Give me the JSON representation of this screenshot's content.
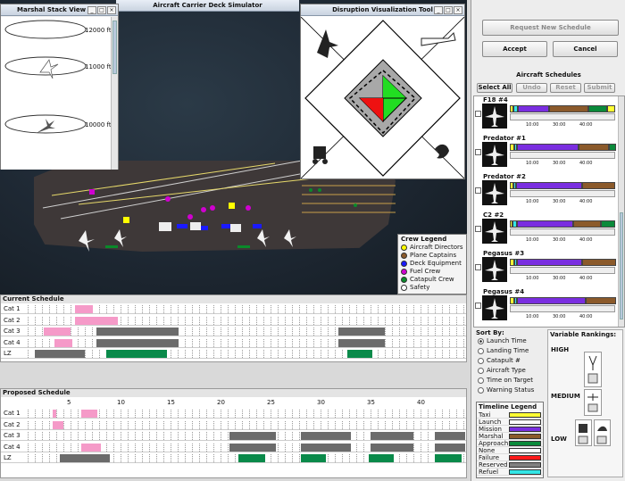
{
  "marshal": {
    "title": "Marshal Stack View",
    "altitudes": [
      "12000 ft",
      "11000 ft",
      "10000 ft"
    ]
  },
  "deck": {
    "title": "Aircraft Carrier Deck Simulator"
  },
  "disruption": {
    "title": "Disruption Visualization Tool"
  },
  "crew_legend": {
    "title": "Crew Legend",
    "items": [
      {
        "label": "Aircraft Directors",
        "color": "#ffff00"
      },
      {
        "label": "Plane Captains",
        "color": "#8b5a2b"
      },
      {
        "label": "Deck Equipment",
        "color": "#1a1aff"
      },
      {
        "label": "Fuel Crew",
        "color": "#d000d0"
      },
      {
        "label": "Catapult Crew",
        "color": "#0a8a2a"
      },
      {
        "label": "Safety",
        "color": "#ffffff"
      }
    ]
  },
  "controls": {
    "request": "Request New Schedule",
    "accept": "Accept",
    "cancel": "Cancel"
  },
  "aircraft_schedules": {
    "title": "Aircraft Schedules",
    "select_all": "Select All",
    "undo": "Undo",
    "reset": "Reset",
    "submit": "Submit",
    "items": [
      {
        "name": "F18 #4",
        "ticks": [
          "10:00",
          "30:00",
          "40:00"
        ]
      },
      {
        "name": "Predator #1",
        "ticks": [
          "10:00",
          "30:00",
          "40:00"
        ]
      },
      {
        "name": "Predator #2",
        "ticks": [
          "10:00",
          "30:00",
          "40:00"
        ]
      },
      {
        "name": "C2 #2",
        "ticks": [
          "10:00",
          "30:00",
          "40:00"
        ]
      },
      {
        "name": "Pegasus #3",
        "ticks": [
          "10:00",
          "30:00",
          "40:00"
        ]
      },
      {
        "name": "Pegasus #4",
        "ticks": [
          "10:00",
          "30:00",
          "40:00"
        ]
      }
    ]
  },
  "current_schedule": {
    "title": "Current Schedule",
    "rows": [
      "Cat 1",
      "Cat 2",
      "Cat 3",
      "Cat 4",
      "LZ"
    ]
  },
  "proposed_schedule": {
    "title": "Proposed Schedule",
    "rows": [
      "Cat 1",
      "Cat 2",
      "Cat 3",
      "Cat 4",
      "LZ"
    ],
    "ticks": [
      "5",
      "10",
      "15",
      "20",
      "25",
      "30",
      "35",
      "40"
    ]
  },
  "sort_by": {
    "title": "Sort By:",
    "options": [
      "Launch Time",
      "Landing Time",
      "Catapult #",
      "Aircraft Type",
      "Time on Target",
      "Warning Status"
    ],
    "selected": 0
  },
  "timeline_legend": {
    "title": "Timeline Legend",
    "items": [
      {
        "label": "Taxi",
        "color": "#ffff33"
      },
      {
        "label": "Launch",
        "color": "#ffffff"
      },
      {
        "label": "Mission",
        "color": "#7a2ee0"
      },
      {
        "label": "Marshal",
        "color": "#8b5a2b"
      },
      {
        "label": "Approach",
        "color": "#0a8a3a"
      },
      {
        "label": "None",
        "color": "#ffffff"
      },
      {
        "label": "Failure",
        "color": "#ff1a1a"
      },
      {
        "label": "Reserved",
        "color": "#808080"
      },
      {
        "label": "Refuel",
        "color": "#33e6e6"
      }
    ]
  },
  "rankings": {
    "title": "Variable Rankings:",
    "levels": [
      "HIGH",
      "MEDIUM",
      "LOW"
    ]
  }
}
